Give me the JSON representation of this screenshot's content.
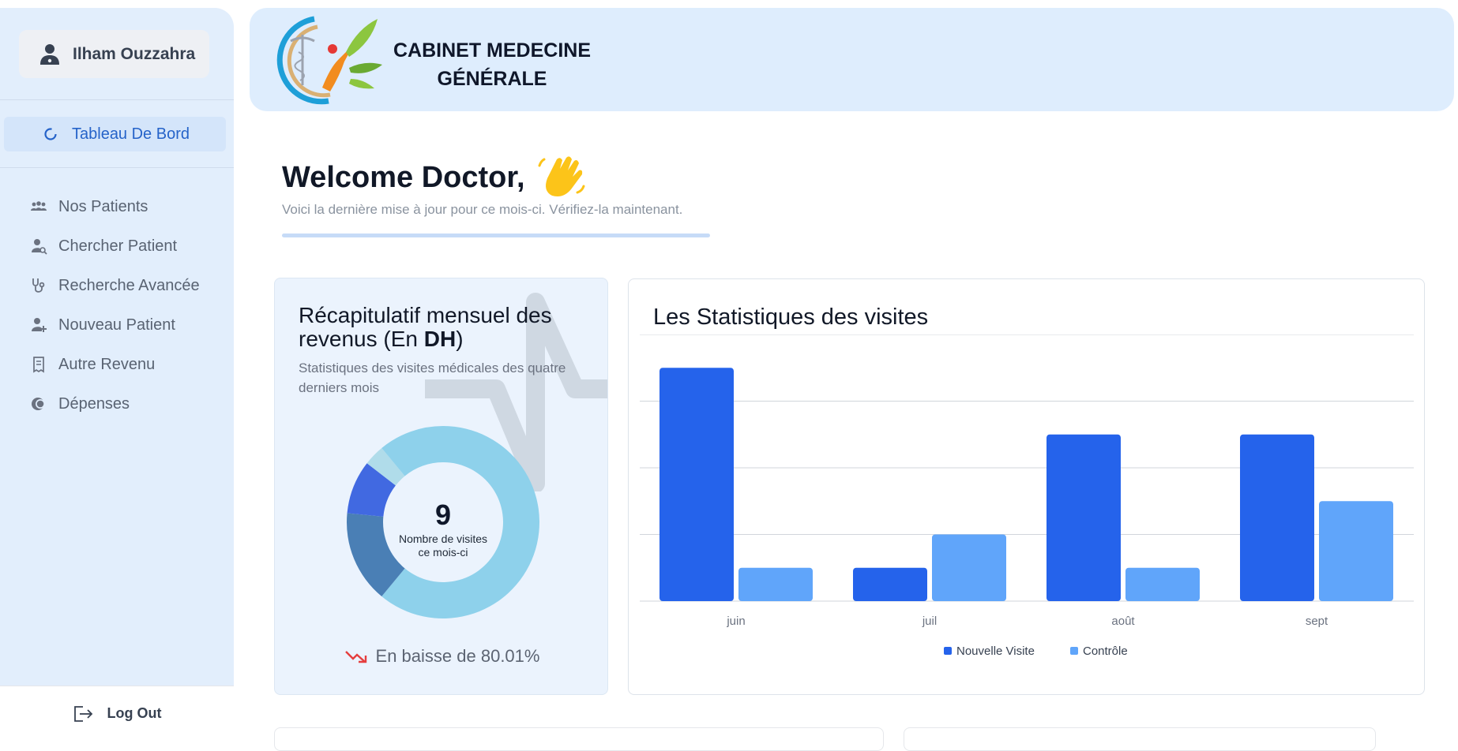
{
  "sidebar": {
    "user_name": "Ilham Ouzzahra",
    "dashboard_label": "Tableau De Bord",
    "items": [
      {
        "label": "Nos Patients",
        "icon": "users-icon"
      },
      {
        "label": "Chercher Patient",
        "icon": "user-search-icon"
      },
      {
        "label": "Recherche Avancée",
        "icon": "stethoscope-icon"
      },
      {
        "label": "Nouveau Patient",
        "icon": "user-plus-icon"
      },
      {
        "label": "Autre Revenu",
        "icon": "receipt-icon"
      },
      {
        "label": "Dépenses",
        "icon": "coins-icon"
      }
    ],
    "logout_label": "Log Out"
  },
  "header": {
    "brand_line1": "CABINET MEDECINE",
    "brand_line2": "GÉNÉRALE"
  },
  "welcome": {
    "title": "Welcome Doctor,",
    "subtitle": "Voici la dernière mise à jour pour ce mois-ci. Vérifiez-la maintenant."
  },
  "revenue_card": {
    "title_part1": "Récapitulatif mensuel des revenus (En ",
    "title_bold": "DH",
    "title_part2": ")",
    "subtitle": "Statistiques des visites médicales des quatre derniers mois",
    "center_value": "9",
    "center_label": "Nombre de visites ce mois-ci",
    "trend_text": "En baisse de 80.01%",
    "donut_segments": [
      {
        "value": 0.61,
        "color": "#8ed1eb"
      },
      {
        "value": 0.155,
        "color": "#4a7fb5"
      },
      {
        "value": 0.09,
        "color": "#4169e1"
      },
      {
        "value": 0.035,
        "color": "#b0dcea"
      },
      {
        "value": 0.11,
        "color": "#8ed1eb"
      }
    ]
  },
  "stats_card": {
    "title": "Les Statistiques des visites"
  },
  "chart_data": {
    "type": "bar",
    "categories": [
      "juin",
      "juil",
      "août",
      "sept"
    ],
    "series": [
      {
        "name": "Nouvelle Visite",
        "values": [
          3.5,
          0.5,
          2.5,
          2.5
        ],
        "color": "#2563eb"
      },
      {
        "name": "Contrôle",
        "values": [
          0.5,
          1,
          0.5,
          1.5
        ],
        "color": "#60a5fa"
      }
    ],
    "ylim": [
      0,
      4
    ],
    "grid": true,
    "legend": "bottom-center"
  }
}
